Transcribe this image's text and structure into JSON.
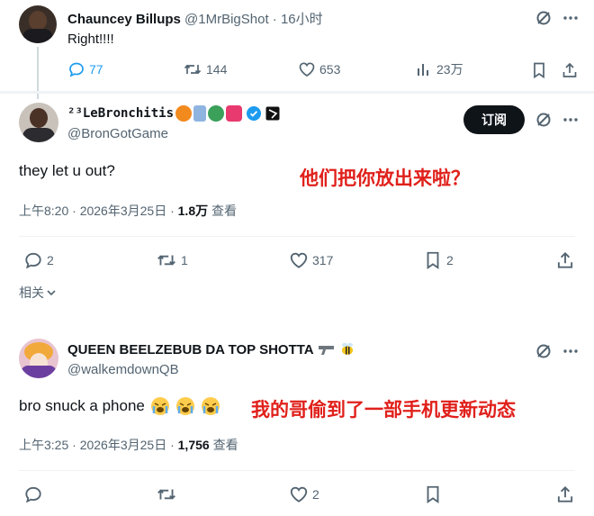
{
  "tweet1": {
    "display_name": "Chauncey Billups",
    "handle_time": "@1MrBigShot · 16小时",
    "text": "Right!!!!",
    "stats": {
      "replies": "77",
      "retweets": "144",
      "likes": "653",
      "views": "23万"
    }
  },
  "tweet2": {
    "display_name": "²³LeBronchitis",
    "handle": "@BronGotGame",
    "subscribe_label": "订阅",
    "text": "they let u out?",
    "annotation": "他们把你放出来啦？",
    "meta_time": "上午8:20 · 2026年3月25日 · ",
    "meta_views": "1.8万",
    "meta_views_label": " 查看",
    "stats": {
      "replies": "2",
      "retweets": "1",
      "likes": "317",
      "bookmarks": "2"
    },
    "related": "相关"
  },
  "tweet3": {
    "display_name": "QUEEN BEELZEBUB DA TOP SHOTTA",
    "handle": "@walkemdownQB",
    "text": "bro snuck a phone",
    "annotation": "我的哥偷到了一部手机更新动态",
    "meta_time": "上午3:25 · 2026年3月25日 · ",
    "meta_views": "1,756",
    "meta_views_label": " 查看",
    "stats": {
      "likes": "2"
    }
  },
  "colors": {
    "accent": "#1d9bf0",
    "annotation": "#e0201b",
    "verified": "#1d9bf0"
  }
}
